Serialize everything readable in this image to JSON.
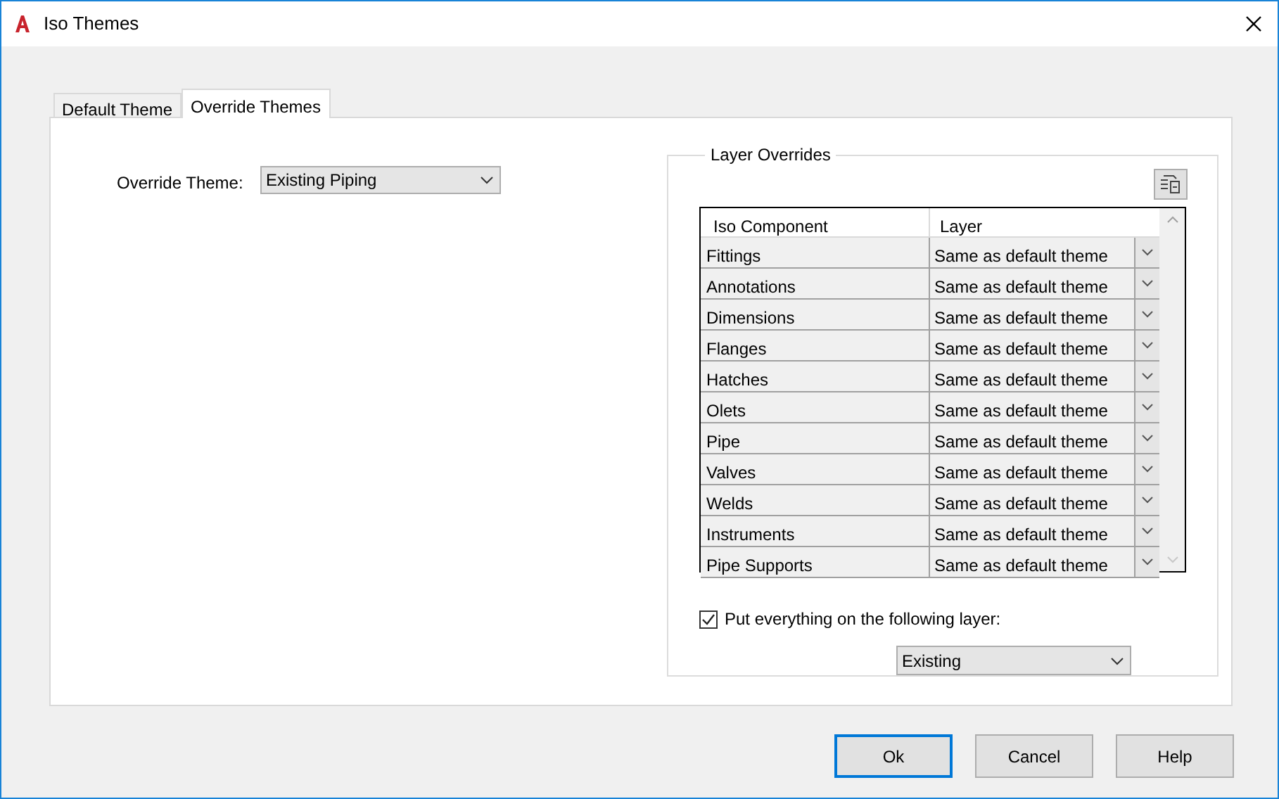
{
  "window": {
    "title": "Iso Themes"
  },
  "tabs": [
    {
      "label": "Default Theme",
      "selected": false
    },
    {
      "label": "Override Themes",
      "selected": true
    }
  ],
  "override_theme": {
    "label": "Override Theme:",
    "value": "Existing Piping"
  },
  "layer_overrides": {
    "title": "Layer Overrides",
    "columns": [
      "Iso Component",
      "Layer"
    ],
    "rows": [
      {
        "component": "Fittings",
        "layer": "Same as default theme"
      },
      {
        "component": "Annotations",
        "layer": "Same as default theme"
      },
      {
        "component": "Dimensions",
        "layer": "Same as default theme"
      },
      {
        "component": "Flanges",
        "layer": "Same as default theme"
      },
      {
        "component": "Hatches",
        "layer": "Same as default theme"
      },
      {
        "component": "Olets",
        "layer": "Same as default theme"
      },
      {
        "component": "Pipe",
        "layer": "Same as default theme"
      },
      {
        "component": "Valves",
        "layer": "Same as default theme"
      },
      {
        "component": "Welds",
        "layer": "Same as default theme"
      },
      {
        "component": "Instruments",
        "layer": "Same as default theme"
      },
      {
        "component": "Pipe Supports",
        "layer": "Same as default theme"
      }
    ]
  },
  "put_everything": {
    "label": "Put everything on the following layer:",
    "checked": true,
    "layer": "Existing"
  },
  "buttons": [
    {
      "label": "Ok",
      "focused": true
    },
    {
      "label": "Cancel",
      "focused": false
    },
    {
      "label": "Help",
      "focused": false
    }
  ]
}
